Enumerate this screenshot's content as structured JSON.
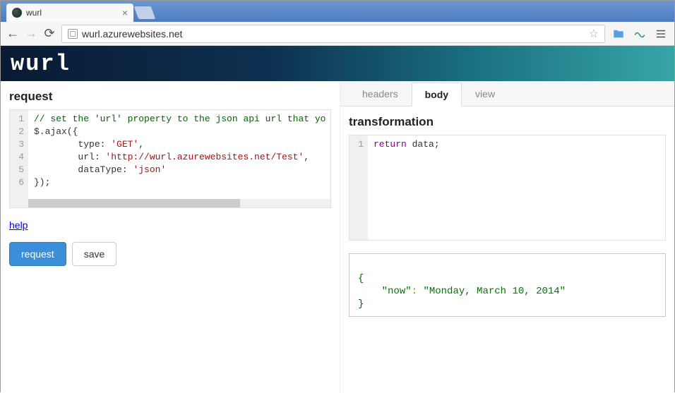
{
  "browser": {
    "tab_title": "wurl",
    "url": "wurl.azurewebsites.net"
  },
  "header": {
    "logo_text": "wurl"
  },
  "left": {
    "title": "request",
    "code_lines": [
      "// set the 'url' property to the json api url that yo",
      "$.ajax({",
      "        type: 'GET',",
      "        url: 'http://wurl.azurewebsites.net/Test',",
      "        dataType: 'json'",
      "});"
    ],
    "help_label": "help",
    "request_button": "request",
    "save_button": "save"
  },
  "right": {
    "tabs": {
      "headers": "headers",
      "body": "body",
      "view": "view",
      "active": "body"
    },
    "transformation_title": "transformation",
    "transformation_code": [
      "return data;"
    ],
    "output": {
      "open": "{",
      "key": "\"now\"",
      "colon": ": ",
      "value": "\"Monday, March 10, 2014\"",
      "close": "}"
    }
  }
}
